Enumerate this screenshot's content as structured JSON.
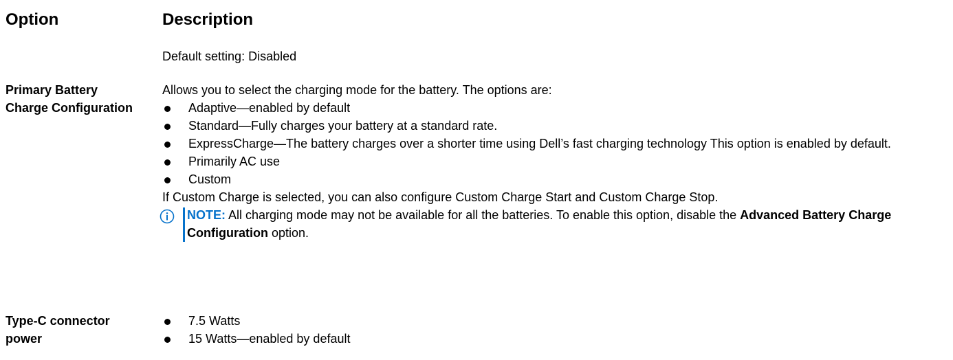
{
  "header": {
    "option": "Option",
    "description": "Description"
  },
  "row0": {
    "default_setting": "Default setting: Disabled"
  },
  "row1": {
    "option_label": "Primary Battery Charge Configuration",
    "intro": "Allows you to select the charging mode for the battery. The options are:",
    "items": [
      "Adaptive—enabled by default",
      "Standard—Fully charges your battery at a standard rate.",
      "ExpressCharge—The battery charges over a shorter time using Dell’s fast charging technology This option is enabled by default.",
      "Primarily AC use",
      "Custom"
    ],
    "custom_text": "If Custom Charge is selected, you can also configure Custom Charge Start and Custom Charge Stop.",
    "note": {
      "label": "NOTE:",
      "text_before": " All charging mode may not be available for all the batteries. To enable this option, disable the ",
      "bold_text": "Advanced Battery Charge Configuration",
      "text_after": " option."
    }
  },
  "row2": {
    "option_label": "Type-C connector power",
    "items": [
      "7.5 Watts",
      "15 Watts—enabled by default"
    ]
  },
  "colors": {
    "note_accent": "#0672cb",
    "text": "#000000"
  }
}
